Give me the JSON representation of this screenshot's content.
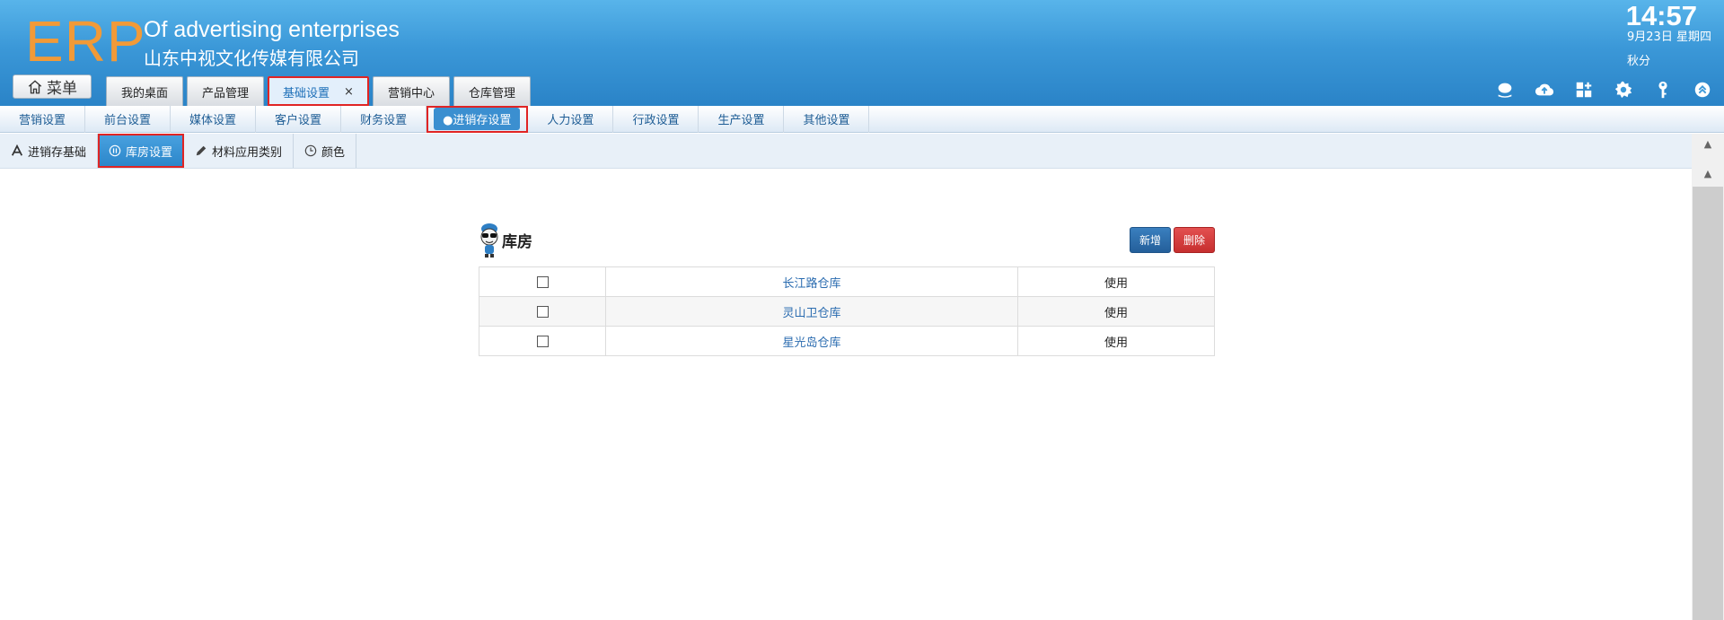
{
  "header": {
    "logo": "ERP",
    "brand_en": "Of advertising enterprises",
    "brand_cn": "山东中视文化传媒有限公司",
    "time": "14:57",
    "date": "9月23日 星期四",
    "season": "秋分",
    "menu_label": "菜单"
  },
  "top_tabs": [
    {
      "label": "我的桌面"
    },
    {
      "label": "产品管理"
    },
    {
      "label": "基础设置",
      "close": "×"
    },
    {
      "label": "营销中心"
    },
    {
      "label": "仓库管理"
    }
  ],
  "subnav": [
    {
      "label": "营销设置"
    },
    {
      "label": "前台设置"
    },
    {
      "label": "媒体设置"
    },
    {
      "label": "客户设置"
    },
    {
      "label": "财务设置"
    },
    {
      "label": "●进销存设置"
    },
    {
      "label": "人力设置"
    },
    {
      "label": "行政设置"
    },
    {
      "label": "生产设置"
    },
    {
      "label": "其他设置"
    }
  ],
  "thirdnav": [
    {
      "label": "进销存基础"
    },
    {
      "label": "库房设置"
    },
    {
      "label": "材料应用类别"
    },
    {
      "label": "颜色"
    }
  ],
  "content": {
    "title": "库房",
    "add_label": "新增",
    "delete_label": "删除",
    "rows": [
      {
        "name": "长江路仓库",
        "status": "使用"
      },
      {
        "name": "灵山卫仓库",
        "status": "使用"
      },
      {
        "name": "星光岛仓库",
        "status": "使用"
      }
    ]
  },
  "colors": {
    "header_top": "#58b4ea",
    "header_bottom": "#2a83c7",
    "logo": "#f19a38",
    "highlight_border": "#e02424",
    "active_pill": "#3b8fd0",
    "add_button": "#2f6fae",
    "delete_button": "#d43f3f"
  },
  "icons": {
    "menu": "home-icon",
    "tools": [
      "chat-icon",
      "cloud-upload-icon",
      "grid-add-icon",
      "gear-icon",
      "key-icon",
      "collapse-up-icon"
    ]
  }
}
